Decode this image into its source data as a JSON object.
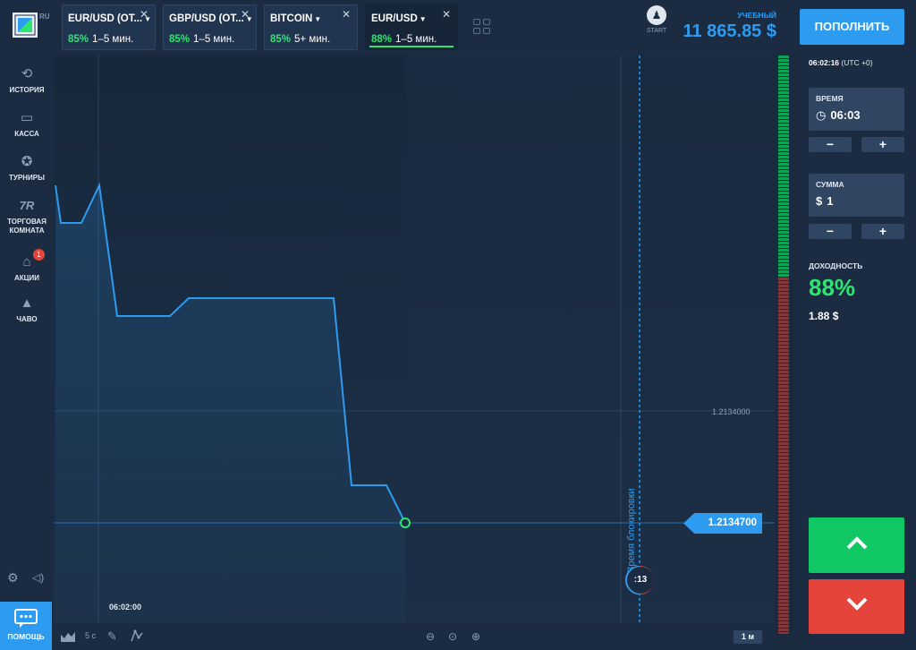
{
  "logo": {
    "region": "RU"
  },
  "tabs": [
    {
      "name": "EUR/USD (OT...",
      "payout": "85%",
      "duration": "1–5 мин.",
      "active": false
    },
    {
      "name": "GBP/USD (OT...",
      "payout": "85%",
      "duration": "1–5 мин.",
      "active": false
    },
    {
      "name": "BITCOIN",
      "payout": "85%",
      "duration": "5+ мин.",
      "active": false
    },
    {
      "name": "EUR/USD",
      "payout": "88%",
      "duration": "1–5 мин.",
      "active": true
    }
  ],
  "header": {
    "start_label": "START",
    "account_type": "УЧЕБНЫЙ",
    "balance": "11 865.85 $",
    "deposit_label": "ПОПОЛНИТЬ"
  },
  "sidebar": {
    "items": [
      {
        "label": "ИСТОРИЯ",
        "icon": "history-icon"
      },
      {
        "label": "КАССА",
        "icon": "wallet-icon"
      },
      {
        "label": "ТУРНИРЫ",
        "icon": "tournament-icon"
      },
      {
        "label": "ТОРГОВАЯ КОМНАТА",
        "icon": "trading-room-icon"
      },
      {
        "label": "АКЦИИ",
        "icon": "gift-icon",
        "badge": "1"
      },
      {
        "label": "ЧАВО",
        "icon": "faq-icon"
      }
    ],
    "help_label": "ПОМОЩЬ"
  },
  "chart": {
    "current_price": "1.2134700",
    "level_price": "1.2134000",
    "lock_label": "Время блокировки",
    "timer": ":13",
    "time_label": "06:02:00"
  },
  "toolbar": {
    "interval_label": "5 с",
    "timeframe": "1 м"
  },
  "panel": {
    "server_time": "06:02:16",
    "timezone": "(UTC +0)",
    "time_label": "ВРЕМЯ",
    "time_value": "06:03",
    "amount_label": "СУММА",
    "amount_currency": "$",
    "amount_value": "1",
    "minus": "−",
    "plus": "+",
    "profit_label": "ДОХОДНОСТЬ",
    "profit_pct": "88%",
    "profit_amount": "1.88 $"
  },
  "colors": {
    "accent": "#2d9bf0",
    "up": "#10c863",
    "down": "#e4443a",
    "payout": "#2ee571"
  },
  "sentiment": {
    "up_fraction": 0.38
  }
}
